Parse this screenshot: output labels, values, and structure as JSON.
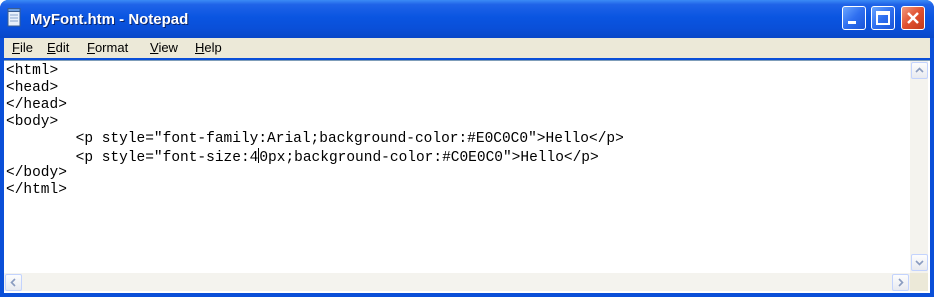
{
  "window": {
    "title": "MyFont.htm - Notepad",
    "icon": "notepad-icon"
  },
  "titlebar_buttons": {
    "minimize_icon": "minimize-icon",
    "maximize_icon": "maximize-icon",
    "close_icon": "close-icon"
  },
  "menu": {
    "items": [
      {
        "accel": "F",
        "rest": "ile"
      },
      {
        "accel": "E",
        "rest": "dit"
      },
      {
        "accel": "F",
        "rest": "ormat",
        "prefix": ""
      },
      {
        "accel": "V",
        "rest": "iew"
      },
      {
        "accel": "H",
        "rest": "elp"
      }
    ]
  },
  "editor": {
    "lines": [
      "<html>",
      "<head>",
      "</head>",
      "<body>",
      "        <p style=\"font-family:Arial;background-color:#E0C0C0\">Hello</p>",
      "        <p style=\"font-size:4",
      "</body>",
      "</html>"
    ],
    "caret_line_rest": "0px;background-color:#C0E0C0\">Hello</p>"
  },
  "colors": {
    "titlebar": "#0a4fd8",
    "menubar": "#ece9d8",
    "close_button": "#e0502f"
  }
}
